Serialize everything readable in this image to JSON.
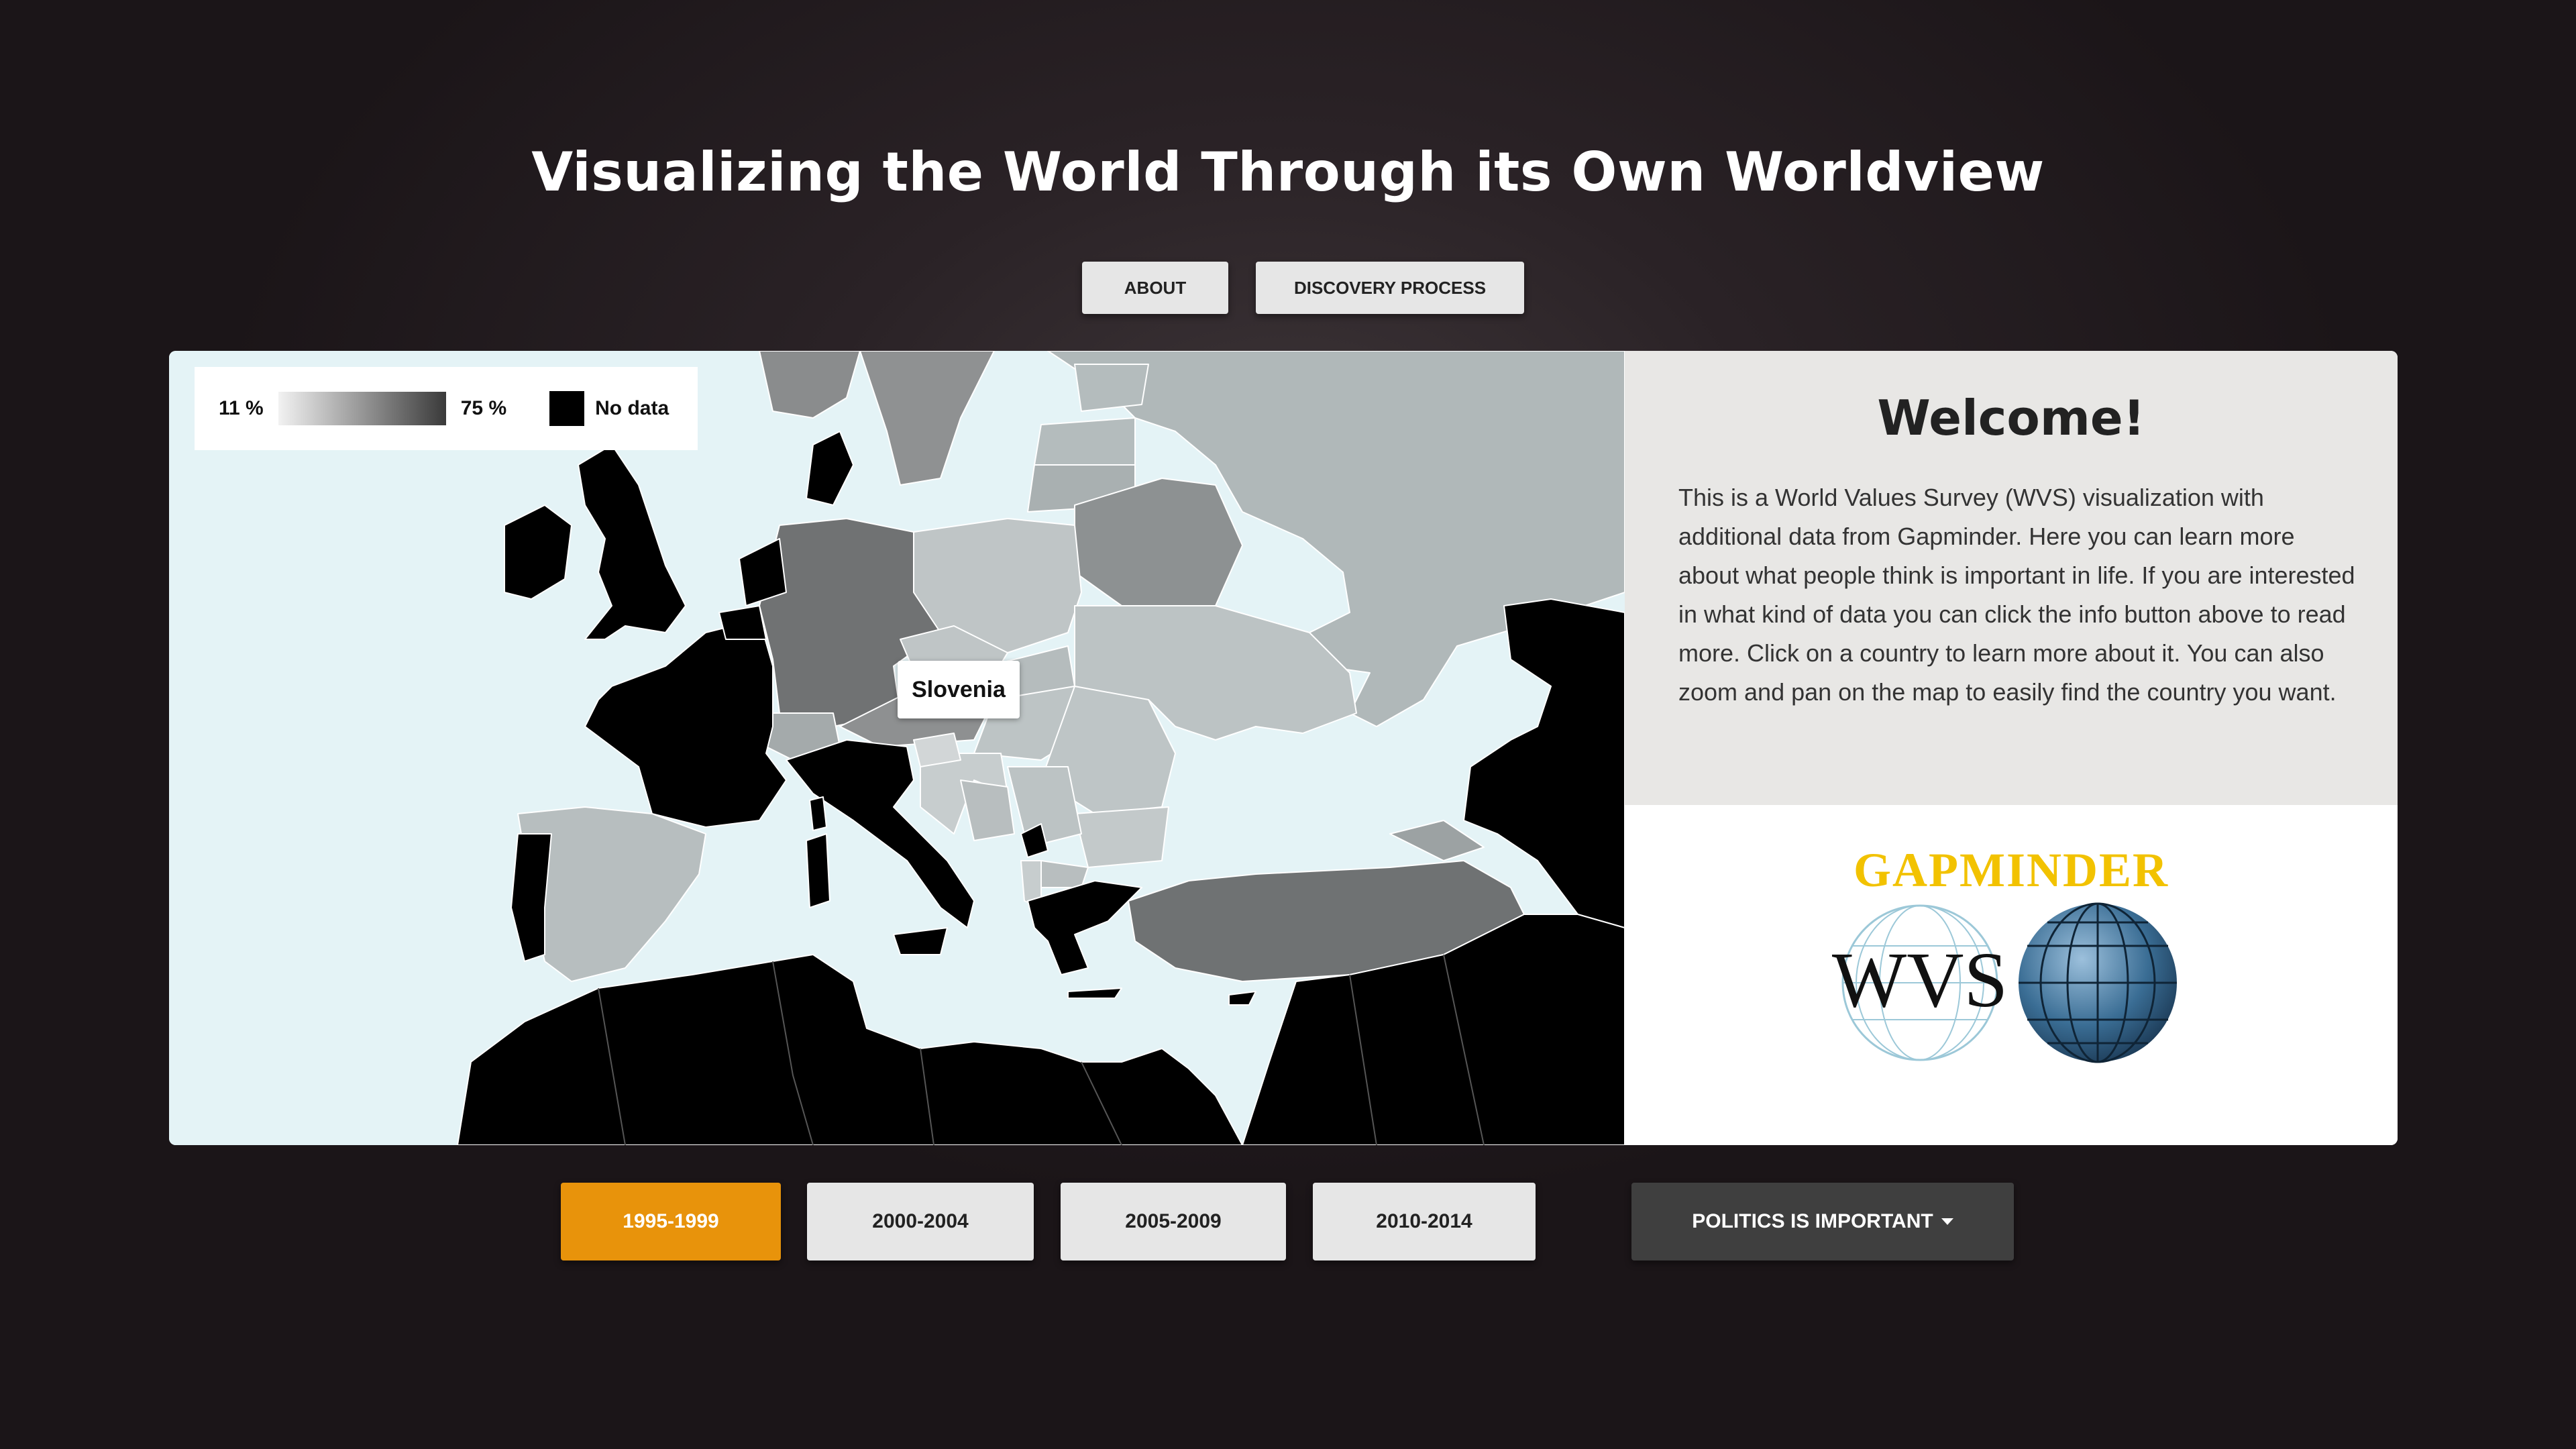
{
  "page": {
    "title": "Visualizing the World Through its Own Worldview"
  },
  "nav": {
    "about": "ABOUT",
    "discovery": "DISCOVERY PROCESS"
  },
  "legend": {
    "min": "11 %",
    "max": "75 %",
    "no_data": "No data"
  },
  "map": {
    "tooltip": "Slovenia"
  },
  "welcome": {
    "title": "Welcome!",
    "text": "This is a World Values Survey (WVS) visualization with additional data from Gapminder. Here you can learn more about what people think is important in life. If you are interested in what kind of data you can click the info button above to read more. Click on a country to learn more about it. You can also zoom and pan on the map to easily find the country you want."
  },
  "logos": {
    "gapminder": "GAPMINDER",
    "wvs": "WVS"
  },
  "years": [
    {
      "label": "1995-1999",
      "active": true
    },
    {
      "label": "2000-2004",
      "active": false
    },
    {
      "label": "2005-2009",
      "active": false
    },
    {
      "label": "2010-2014",
      "active": false
    }
  ],
  "topic": {
    "label": "POLITICS IS IMPORTANT",
    "icon": "caret-down-icon"
  },
  "colors": {
    "accent": "#e8930b",
    "no_data": "#000000",
    "sea": "#e4f3f6",
    "panel": "#e8e7e5",
    "gapminder": "#f2c200"
  }
}
